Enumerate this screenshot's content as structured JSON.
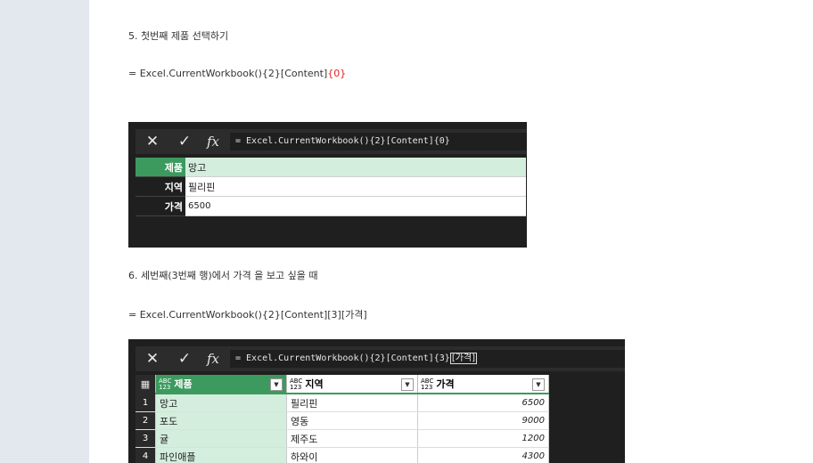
{
  "step5": {
    "heading": "5. 첫번째 제품 선택하기",
    "formula_main": "= Excel.CurrentWorkbook(){2}[Content]",
    "formula_hl": "{0}",
    "screenshot": {
      "formula": "= Excel.CurrentWorkbook(){2}[Content]{0}",
      "record": [
        {
          "key": "제품",
          "value": "망고"
        },
        {
          "key": "지역",
          "value": "필리핀"
        },
        {
          "key": "가격",
          "value": "6500"
        }
      ]
    }
  },
  "step6": {
    "heading": "6. 세번째(3번째 행)에서 가격 을 보고 싶을 때",
    "formula": "= Excel.CurrentWorkbook(){2}[Content][3][가격]",
    "screenshot": {
      "formula_main": "= Excel.CurrentWorkbook(){2}[Content]{3}",
      "formula_box": "[가격]",
      "type_abc": "ABC",
      "type_123": "123",
      "columns": [
        "제품",
        "지역",
        "가격"
      ],
      "rows": [
        {
          "idx": "1",
          "c1": "망고",
          "c2": "필리핀",
          "c3": "6500"
        },
        {
          "idx": "2",
          "c1": "포도",
          "c2": "영동",
          "c3": "9000"
        },
        {
          "idx": "3",
          "c1": "귤",
          "c2": "제주도",
          "c3": "1200"
        },
        {
          "idx": "4",
          "c1": "파인애플",
          "c2": "하와이",
          "c3": "4300"
        }
      ]
    }
  },
  "icons": {
    "close": "✕",
    "check": "✓",
    "fx": "fx",
    "dropdown": "▼",
    "table": "▦"
  }
}
